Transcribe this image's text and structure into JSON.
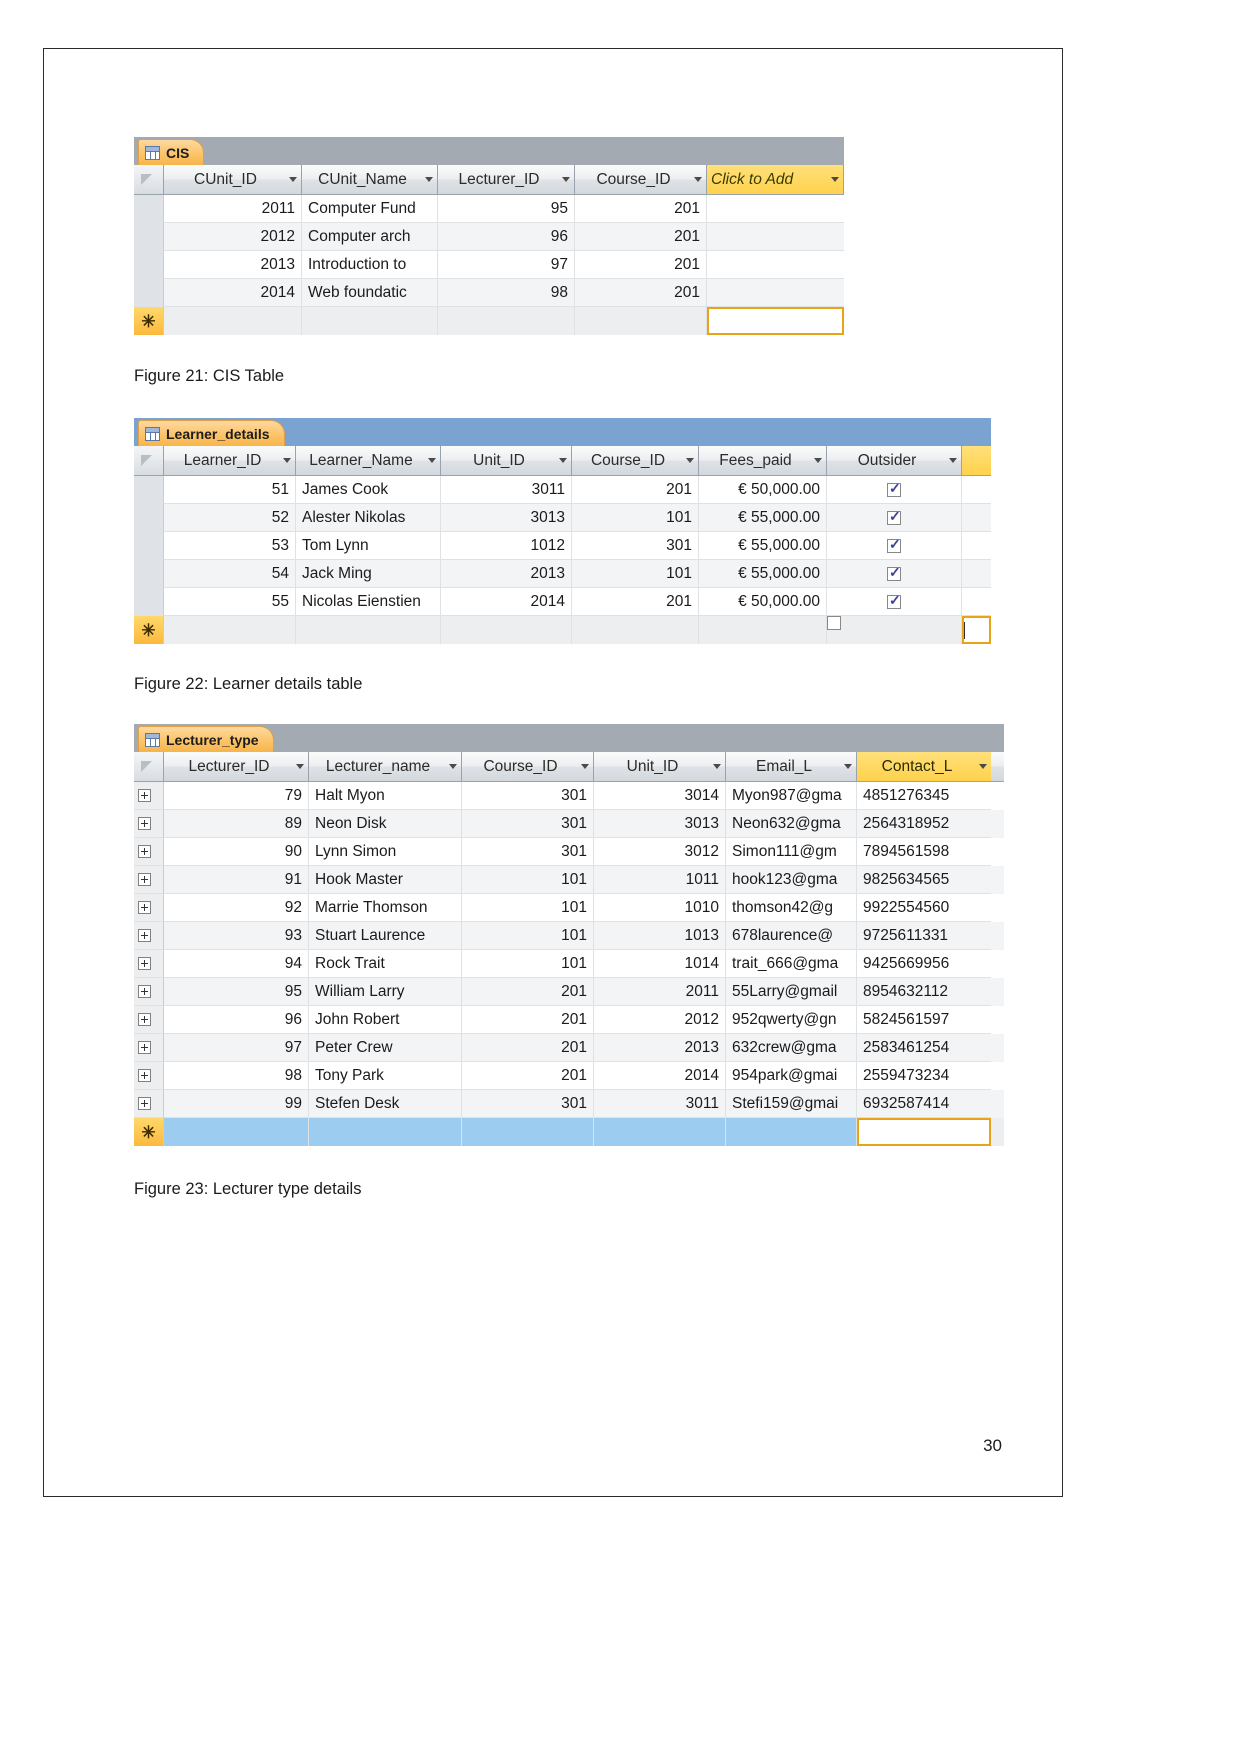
{
  "document": {
    "page_number": "30"
  },
  "figures": [
    {
      "caption": "Figure 21: CIS Table"
    },
    {
      "caption": "Figure 22: Learner details table"
    },
    {
      "caption": "Figure 23: Lecturer type details"
    }
  ],
  "colors": {
    "tab_orange": "#fcc46a",
    "tabbar_gray": "#a3aab2",
    "tabbar_blue": "#7aa3d2",
    "header_gold": "#ffd24d",
    "newrow_blue": "#9ccdf0",
    "focus_outline": "#e8a317",
    "checkmark": "#39439a"
  },
  "cis_table": {
    "tab_label": "CIS",
    "tab_icon": "datasheet-grid-icon",
    "tabbar_style": "gray",
    "columns": [
      {
        "label": "CUnit_ID",
        "align": "num"
      },
      {
        "label": "CUnit_Name",
        "align": "text"
      },
      {
        "label": "Lecturer_ID",
        "align": "num"
      },
      {
        "label": "Course_ID",
        "align": "num"
      },
      {
        "label": "Click to Add",
        "align": "add"
      }
    ],
    "rows": [
      {
        "cunit_id": "2011",
        "cunit_name": "Computer Fund",
        "lecturer_id": "95",
        "course_id": "201"
      },
      {
        "cunit_id": "2012",
        "cunit_name": "Computer arch",
        "lecturer_id": "96",
        "course_id": "201"
      },
      {
        "cunit_id": "2013",
        "cunit_name": "Introduction to",
        "lecturer_id": "97",
        "course_id": "201"
      },
      {
        "cunit_id": "2014",
        "cunit_name": "Web foundatic",
        "lecturer_id": "98",
        "course_id": "201"
      }
    ],
    "new_record_marker": "✳"
  },
  "learner_details_table": {
    "tab_label": "Learner_details",
    "tab_icon": "datasheet-grid-icon",
    "tabbar_style": "blue",
    "columns": [
      {
        "label": "Learner_ID",
        "align": "num"
      },
      {
        "label": "Learner_Name",
        "align": "text"
      },
      {
        "label": "Unit_ID",
        "align": "num"
      },
      {
        "label": "Course_ID",
        "align": "num"
      },
      {
        "label": "Fees_paid",
        "align": "num"
      },
      {
        "label": "Outsider",
        "align": "ctr"
      }
    ],
    "rows": [
      {
        "learner_id": "51",
        "learner_name": "James Cook",
        "unit_id": "3011",
        "course_id": "201",
        "fees_paid": "€ 50,000.00",
        "outsider": true
      },
      {
        "learner_id": "52",
        "learner_name": "Alester Nikolas",
        "unit_id": "3013",
        "course_id": "101",
        "fees_paid": "€ 55,000.00",
        "outsider": true
      },
      {
        "learner_id": "53",
        "learner_name": "Tom Lynn",
        "unit_id": "1012",
        "course_id": "301",
        "fees_paid": "€ 55,000.00",
        "outsider": true
      },
      {
        "learner_id": "54",
        "learner_name": "Jack Ming",
        "unit_id": "2013",
        "course_id": "101",
        "fees_paid": "€ 55,000.00",
        "outsider": true
      },
      {
        "learner_id": "55",
        "learner_name": "Nicolas Eienstien",
        "unit_id": "2014",
        "course_id": "201",
        "fees_paid": "€ 50,000.00",
        "outsider": true
      }
    ],
    "new_record_marker": "✳",
    "new_record_outsider": false
  },
  "lecturer_type_table": {
    "tab_label": "Lecturer_type",
    "tab_icon": "datasheet-grid-icon",
    "tabbar_style": "gray",
    "columns": [
      {
        "label": "Lecturer_ID",
        "align": "num"
      },
      {
        "label": "Lecturer_name",
        "align": "text"
      },
      {
        "label": "Course_ID",
        "align": "num"
      },
      {
        "label": "Unit_ID",
        "align": "num"
      },
      {
        "label": "Email_L",
        "align": "text"
      },
      {
        "label": "Contact_L",
        "align": "text",
        "selected": true
      }
    ],
    "rows": [
      {
        "lecturer_id": "79",
        "lecturer_name": "Halt Myon",
        "course_id": "301",
        "unit_id": "3014",
        "email_l": "Myon987@gma",
        "contact_l": "4851276345"
      },
      {
        "lecturer_id": "89",
        "lecturer_name": "Neon Disk",
        "course_id": "301",
        "unit_id": "3013",
        "email_l": "Neon632@gma",
        "contact_l": "2564318952"
      },
      {
        "lecturer_id": "90",
        "lecturer_name": "Lynn Simon",
        "course_id": "301",
        "unit_id": "3012",
        "email_l": "Simon111@gm",
        "contact_l": "7894561598"
      },
      {
        "lecturer_id": "91",
        "lecturer_name": "Hook Master",
        "course_id": "101",
        "unit_id": "1011",
        "email_l": "hook123@gma",
        "contact_l": "9825634565"
      },
      {
        "lecturer_id": "92",
        "lecturer_name": "Marrie Thomson",
        "course_id": "101",
        "unit_id": "1010",
        "email_l": "thomson42@g",
        "contact_l": "9922554560"
      },
      {
        "lecturer_id": "93",
        "lecturer_name": "Stuart Laurence",
        "course_id": "101",
        "unit_id": "1013",
        "email_l": "678laurence@",
        "contact_l": "9725611331"
      },
      {
        "lecturer_id": "94",
        "lecturer_name": "Rock Trait",
        "course_id": "101",
        "unit_id": "1014",
        "email_l": "trait_666@gma",
        "contact_l": "9425669956"
      },
      {
        "lecturer_id": "95",
        "lecturer_name": "William Larry",
        "course_id": "201",
        "unit_id": "2011",
        "email_l": "55Larry@gmail",
        "contact_l": "8954632112"
      },
      {
        "lecturer_id": "96",
        "lecturer_name": "John Robert",
        "course_id": "201",
        "unit_id": "2012",
        "email_l": "952qwerty@gn",
        "contact_l": "5824561597"
      },
      {
        "lecturer_id": "97",
        "lecturer_name": "Peter Crew",
        "course_id": "201",
        "unit_id": "2013",
        "email_l": "632crew@gma",
        "contact_l": "2583461254"
      },
      {
        "lecturer_id": "98",
        "lecturer_name": "Tony Park",
        "course_id": "201",
        "unit_id": "2014",
        "email_l": "954park@gmai",
        "contact_l": "2559473234"
      },
      {
        "lecturer_id": "99",
        "lecturer_name": "Stefen Desk",
        "course_id": "301",
        "unit_id": "3011",
        "email_l": "Stefi159@gmai",
        "contact_l": "6932587414"
      }
    ],
    "new_record_marker": "✳",
    "expander_icon": "plus-expand-icon"
  }
}
